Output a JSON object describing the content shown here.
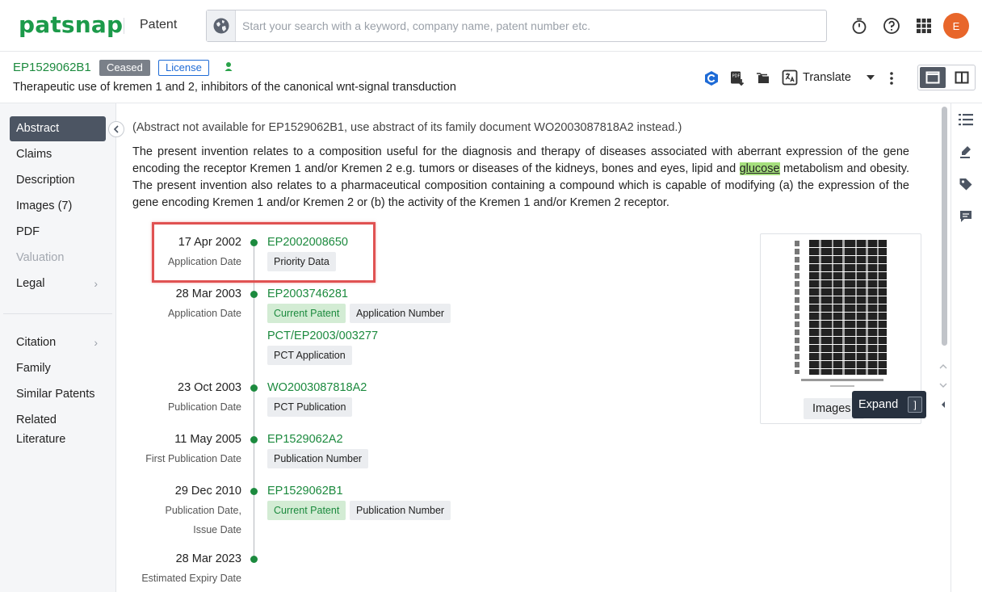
{
  "brand": {
    "logo": "patsnap",
    "product": "Patent",
    "accent": "#1c9a4a"
  },
  "search": {
    "placeholder": "Start your search with a keyword, company name, patent number etc.",
    "value": ""
  },
  "topbar_icons": [
    "timer-icon",
    "help-icon",
    "apps-grid-icon"
  ],
  "user": {
    "initial": "E",
    "avatar_color": "#e8662a"
  },
  "patent": {
    "number": "EP1529062B1",
    "status": "Ceased",
    "license": "License",
    "title": "Therapeutic use of kremen 1 and 2, inhibitors of the canonical wnt-signal transduction"
  },
  "toolbar": {
    "translate_label": "Translate"
  },
  "sidebar": {
    "items": [
      {
        "label": "Abstract",
        "active": true
      },
      {
        "label": "Claims"
      },
      {
        "label": "Description"
      },
      {
        "label": "Images (7)"
      },
      {
        "label": "PDF"
      },
      {
        "label": "Valuation",
        "disabled": true
      },
      {
        "label": "Legal",
        "has_chevron": true
      },
      {
        "label": "Citation",
        "has_chevron": true
      },
      {
        "label": "Family"
      },
      {
        "label": "Similar Patents"
      },
      {
        "label": "Related"
      },
      {
        "label": "Literature"
      }
    ]
  },
  "abstract": {
    "note": "(Abstract not available for EP1529062B1, use abstract of its family document WO2003087818A2 instead.)",
    "text_before": "The present invention relates to a composition useful for the diagnosis and therapy of diseases associated with aberrant expression of the gene encoding the receptor Kremen 1 and/or Kremen 2 e.g. tumors or diseases of the kidneys, bones and eyes, lipid and ",
    "highlight": "glucose",
    "text_after": " metabolism and obesity. The present invention also relates to a pharmaceutical composition containing a compound which is capable of modifying (a) the expression of the gene encoding Kremen 1 and/or Kremen 2 or (b) the activity of the Kremen 1 and/or Kremen 2 receptor."
  },
  "timeline": [
    {
      "date": "17 Apr 2002",
      "type": "Application Date",
      "link": "EP2002008650",
      "tags": [
        {
          "label": "Priority Data"
        }
      ]
    },
    {
      "date": "28 Mar 2003",
      "type": "Application Date",
      "link": "EP2003746281",
      "tags": [
        {
          "label": "Current Patent",
          "green": true
        },
        {
          "label": "Application Number"
        }
      ],
      "link2": "PCT/EP2003/003277",
      "tags2": [
        {
          "label": "PCT Application"
        }
      ]
    },
    {
      "date": "23 Oct 2003",
      "type": "Publication Date",
      "link": "WO2003087818A2",
      "tags": [
        {
          "label": "PCT Publication"
        }
      ]
    },
    {
      "date": "11 May 2005",
      "type": "First Publication Date",
      "link": "EP1529062A2",
      "tags": [
        {
          "label": "Publication Number"
        }
      ]
    },
    {
      "date": "29 Dec 2010",
      "type": "Publication Date,",
      "type2": "Issue Date",
      "link": "EP1529062B1",
      "tags": [
        {
          "label": "Current Patent",
          "green": true
        },
        {
          "label": "Publication Number"
        }
      ]
    },
    {
      "date": "28 Mar 2023",
      "type": "Estimated Expiry Date"
    }
  ],
  "images_card": {
    "button_label": "Images",
    "tooltip_label": "Expand",
    "tooltip_key": "]"
  },
  "rail_icons": [
    "list-icon",
    "highlighter-icon",
    "tag-icon",
    "comment-icon"
  ]
}
